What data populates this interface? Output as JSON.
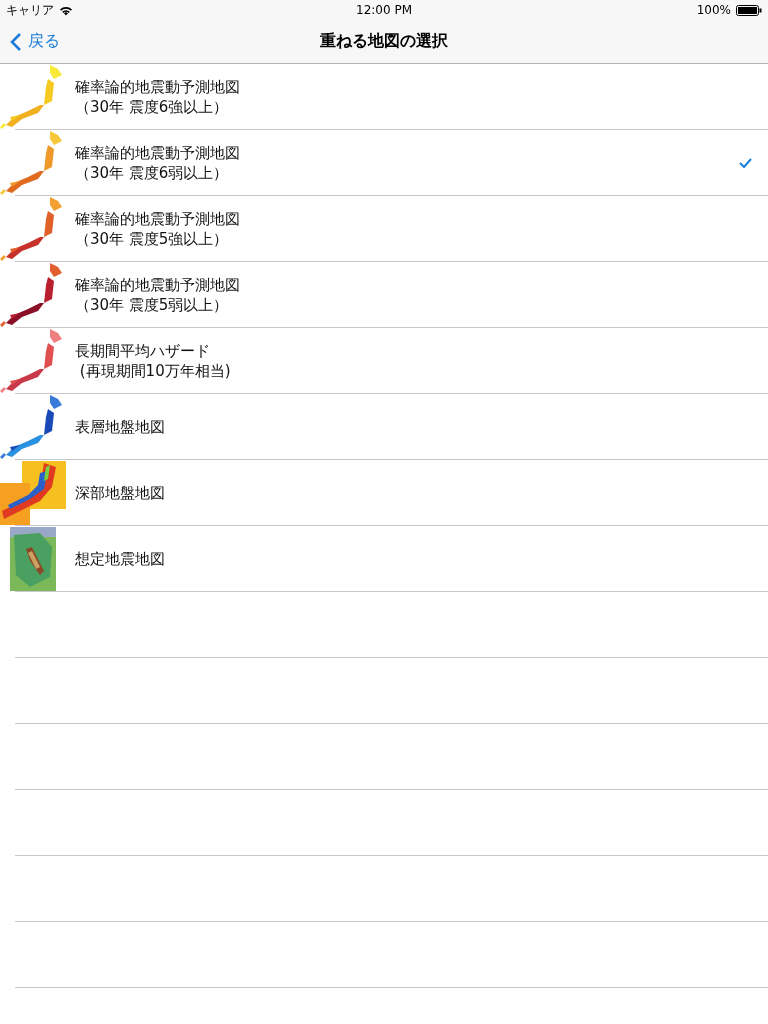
{
  "status_bar": {
    "carrier": "キャリア",
    "time": "12:00 PM",
    "battery": "100%"
  },
  "nav": {
    "back": "戻る",
    "title": "重ねる地図の選択"
  },
  "items": [
    {
      "label": "確率論的地震動予測地図",
      "sublabel": "（30年 震度6強以上）",
      "selected": false
    },
    {
      "label": "確率論的地震動予測地図",
      "sublabel": "（30年 震度6弱以上）",
      "selected": true
    },
    {
      "label": "確率論的地震動予測地図",
      "sublabel": "（30年 震度5強以上）",
      "selected": false
    },
    {
      "label": "確率論的地震動予測地図",
      "sublabel": "（30年 震度5弱以上）",
      "selected": false
    },
    {
      "label": "長期間平均ハザード",
      "sublabel": " (再現期間10万年相当)",
      "selected": false
    },
    {
      "label": "表層地盤地図",
      "selected": false
    },
    {
      "label": "深部地盤地図",
      "selected": false
    },
    {
      "label": "想定地震地図",
      "selected": false
    }
  ]
}
